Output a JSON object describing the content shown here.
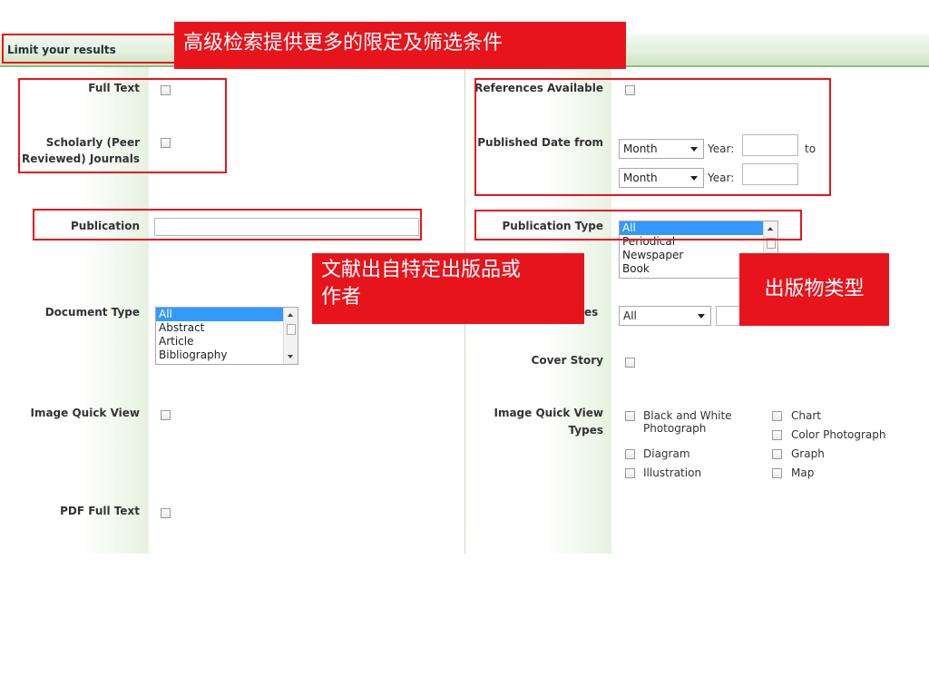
{
  "header": {
    "title": "Limit your results"
  },
  "left": {
    "full_text": {
      "label": "Full Text"
    },
    "scholarly": {
      "label_line1": "Scholarly (Peer",
      "label_line2": "Reviewed) Journals"
    },
    "publication": {
      "label": "Publication",
      "value": ""
    },
    "document_type": {
      "label": "Document Type",
      "options": [
        "All",
        "Abstract",
        "Article",
        "Bibliography"
      ],
      "selected": "All"
    },
    "image_quick_view": {
      "label": "Image Quick View"
    },
    "pdf_full_text": {
      "label": "PDF Full Text"
    }
  },
  "right": {
    "references": {
      "label": "References Available"
    },
    "published_date": {
      "label": "Published Date from",
      "from_month": "Month",
      "year_label": "Year:",
      "to_label": "to",
      "to_month": "Month"
    },
    "publication_type": {
      "label": "Publication Type",
      "options": [
        "All",
        "Periodical",
        "Newspaper",
        "Book"
      ],
      "selected": "All"
    },
    "pages": {
      "label_fragment": "es",
      "select_value": "All"
    },
    "cover_story": {
      "label": "Cover Story"
    },
    "image_types": {
      "label_line1": "Image Quick View",
      "label_line2": "Types",
      "options": [
        {
          "line1": "Black and White",
          "line2": "Photograph"
        },
        {
          "line1": "Chart",
          "line2": ""
        },
        {
          "line1": "Color Photograph",
          "line2": ""
        },
        {
          "line1": "Diagram",
          "line2": ""
        },
        {
          "line1": "Graph",
          "line2": ""
        },
        {
          "line1": "Illustration",
          "line2": ""
        },
        {
          "line1": "Map",
          "line2": ""
        }
      ]
    }
  },
  "annotations": {
    "advanced": "高级检索提供更多的限定及筛选条件",
    "source_line1": "文献出自特定出版品或",
    "source_line2": "作者",
    "pubtype": "出版物类型"
  },
  "colors": {
    "annotation_red": "#e8141c",
    "header_green": "#cfe4c6"
  }
}
